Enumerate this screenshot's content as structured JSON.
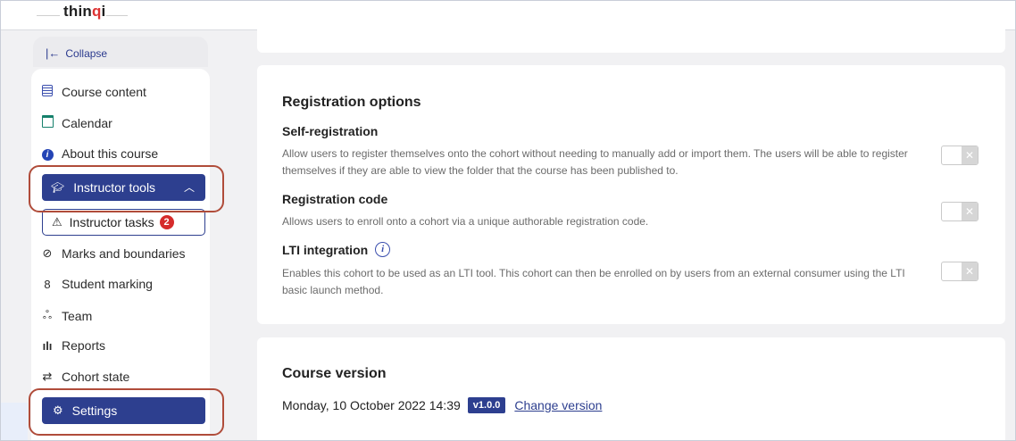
{
  "header": {
    "logo_prefix": "thin",
    "logo_dot": "q",
    "logo_suffix": "i"
  },
  "sidebar": {
    "collapse_label": "Collapse",
    "items": [
      {
        "label": "Course content",
        "icon": "course-content-icon"
      },
      {
        "label": "Calendar",
        "icon": "calendar-icon"
      },
      {
        "label": "About this course",
        "icon": "info-icon"
      }
    ],
    "instructor_tools": {
      "label": "Instructor tools",
      "icon": "graduation-cap-icon"
    },
    "sub_items": [
      {
        "label": "Instructor tasks",
        "icon": "warning-icon",
        "badge": "2"
      },
      {
        "label": "Marks and boundaries",
        "icon": "check-circle-icon"
      },
      {
        "label": "Student marking",
        "icon": "person-icon"
      },
      {
        "label": "Team",
        "icon": "team-icon"
      },
      {
        "label": "Reports",
        "icon": "bar-chart-icon"
      },
      {
        "label": "Cohort state",
        "icon": "state-icon"
      }
    ],
    "settings": {
      "label": "Settings",
      "icon": "gear-icon"
    }
  },
  "registration": {
    "heading": "Registration options",
    "options": [
      {
        "title": "Self-registration",
        "description": "Allow users to register themselves onto the cohort without needing to manually add or import them. The users will be able to register themselves if they are able to view the folder that the course has been published to.",
        "enabled": false
      },
      {
        "title": "Registration code",
        "description": "Allows users to enroll onto a cohort via a unique authorable registration code.",
        "enabled": false
      },
      {
        "title": "LTI integration",
        "description": "Enables this cohort to be used as an LTI tool. This cohort can then be enrolled on by users from an external consumer using the LTI basic launch method.",
        "enabled": false
      }
    ]
  },
  "course_version": {
    "heading": "Course version",
    "date": "Monday, 10 October 2022 14:39",
    "version": "v1.0.0",
    "change_link": "Change version"
  },
  "colors": {
    "primary": "#2d3f8f",
    "highlight_ring": "#b04c3a",
    "badge": "#d62b2b"
  }
}
